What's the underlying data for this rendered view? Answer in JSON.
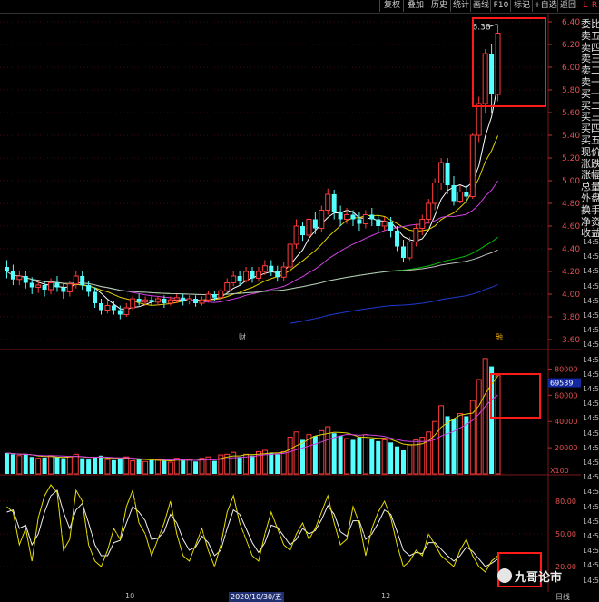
{
  "toolbar": {
    "buttons": [
      "复权",
      "叠加",
      "历史",
      "统计",
      "画线",
      "F10",
      "标记",
      "+自选",
      "返回"
    ],
    "corner": [
      "L",
      "R"
    ]
  },
  "right_panel": {
    "rows": [
      "委比",
      "卖五",
      "卖四",
      "卖三",
      "卖二",
      "卖一",
      "买一",
      "买二",
      "买三",
      "买四",
      "买五",
      "现价",
      "涨跌",
      "涨幅",
      "总量",
      "外盘",
      "换手",
      "净资",
      "收益"
    ]
  },
  "time_ticks": [
    "14:5",
    "14:5",
    "14:5",
    "14:5",
    "14:5",
    "14:5",
    "14:5",
    "14:5",
    "14:5",
    "14:5",
    "14:5",
    "14:5",
    "14:5",
    "14:5",
    "14:5",
    "14:5",
    "14:5",
    "14:5",
    "14:5",
    "14:5",
    "14:5",
    "14:5",
    "14:5",
    "14:5",
    "14:5",
    "14:5",
    "14:5",
    "14:5",
    "14:5",
    "14:5",
    "14:5",
    "14:5",
    "14:5",
    "14:5",
    "14:5",
    "14:5",
    "14:5",
    "14:5",
    "14:5",
    "14:5",
    "14:5",
    "14:5",
    "14:5",
    "14:5",
    "14:5",
    "14:5",
    "14:5",
    "14:5",
    "14:5",
    "14:5",
    "14:5",
    "14:5",
    "14:5",
    "14:5",
    "14:5",
    "14:5",
    "14:5",
    "14:5",
    "14:5",
    "14:5",
    "14:5",
    "14:5",
    "14:5",
    "14:5",
    "14:5",
    "14:5",
    "14:5",
    "14:5",
    "14:5",
    "14:5"
  ],
  "bottom_axis": {
    "labels": [
      "10",
      "2020/10/30/五",
      "12"
    ],
    "right_label": "日线"
  },
  "watermark": "九哥论市",
  "chart_data": {
    "type": "candlestick",
    "price_axis": {
      "ticks": [
        "6.40",
        "6.20",
        "6.00",
        "5.80",
        "5.60",
        "5.40",
        "5.20",
        "5.00",
        "4.80",
        "4.60",
        "4.40",
        "4.20",
        "4.00",
        "3.80",
        "3.60"
      ],
      "ylim": [
        3.52,
        6.48
      ]
    },
    "high_label": "6.38",
    "markers": [
      "财",
      "融"
    ],
    "candles": [
      [
        4.24,
        4.2,
        4.3,
        4.14
      ],
      [
        4.2,
        4.13,
        4.26,
        4.08
      ],
      [
        4.13,
        4.16,
        4.2,
        4.08
      ],
      [
        4.16,
        4.1,
        4.2,
        4.05
      ],
      [
        4.1,
        4.06,
        4.15,
        4.0
      ],
      [
        4.06,
        4.08,
        4.12,
        4.01
      ],
      [
        4.08,
        4.04,
        4.12,
        3.98
      ],
      [
        4.04,
        4.1,
        4.14,
        4.0
      ],
      [
        4.1,
        4.06,
        4.16,
        4.02
      ],
      [
        4.06,
        4.02,
        4.1,
        3.96
      ],
      [
        4.02,
        4.09,
        4.12,
        3.98
      ],
      [
        4.09,
        4.16,
        4.2,
        4.05
      ],
      [
        4.16,
        4.08,
        4.2,
        4.04
      ],
      [
        4.08,
        4.02,
        4.12,
        3.98
      ],
      [
        4.02,
        3.92,
        4.06,
        3.88
      ],
      [
        3.92,
        3.86,
        3.96,
        3.82
      ],
      [
        3.86,
        3.9,
        3.95,
        3.83
      ],
      [
        3.9,
        3.86,
        3.94,
        3.82
      ],
      [
        3.86,
        3.82,
        3.9,
        3.78
      ],
      [
        3.82,
        3.88,
        3.92,
        3.8
      ],
      [
        3.88,
        3.96,
        3.99,
        3.86
      ],
      [
        3.96,
        3.93,
        4.0,
        3.9
      ],
      [
        3.93,
        3.95,
        3.98,
        3.9
      ],
      [
        3.95,
        3.93,
        3.98,
        3.9
      ],
      [
        3.93,
        3.96,
        3.98,
        3.9
      ],
      [
        3.96,
        3.92,
        3.99,
        3.88
      ],
      [
        3.92,
        3.95,
        3.98,
        3.9
      ],
      [
        3.95,
        3.97,
        4.0,
        3.92
      ],
      [
        3.97,
        3.94,
        4.0,
        3.9
      ],
      [
        3.94,
        3.96,
        3.99,
        3.91
      ],
      [
        3.96,
        3.92,
        3.99,
        3.89
      ],
      [
        3.92,
        3.95,
        3.98,
        3.9
      ],
      [
        3.95,
        4.0,
        4.03,
        3.93
      ],
      [
        4.0,
        3.97,
        4.03,
        3.94
      ],
      [
        3.97,
        4.03,
        4.06,
        3.95
      ],
      [
        4.03,
        4.1,
        4.14,
        4.01
      ],
      [
        4.1,
        4.16,
        4.2,
        4.07
      ],
      [
        4.16,
        4.12,
        4.2,
        4.08
      ],
      [
        4.12,
        4.2,
        4.24,
        4.1
      ],
      [
        4.2,
        4.14,
        4.24,
        4.1
      ],
      [
        4.14,
        4.2,
        4.24,
        4.11
      ],
      [
        4.2,
        4.25,
        4.3,
        4.17
      ],
      [
        4.25,
        4.2,
        4.3,
        4.16
      ],
      [
        4.2,
        4.15,
        4.25,
        4.11
      ],
      [
        4.15,
        4.24,
        4.28,
        4.12
      ],
      [
        4.24,
        4.44,
        4.48,
        4.22
      ],
      [
        4.44,
        4.6,
        4.66,
        4.4
      ],
      [
        4.6,
        4.52,
        4.64,
        4.47
      ],
      [
        4.52,
        4.66,
        4.7,
        4.48
      ],
      [
        4.66,
        4.58,
        4.72,
        4.53
      ],
      [
        4.58,
        4.74,
        4.78,
        4.55
      ],
      [
        4.74,
        4.88,
        4.93,
        4.7
      ],
      [
        4.88,
        4.72,
        4.92,
        4.66
      ],
      [
        4.72,
        4.66,
        4.78,
        4.6
      ],
      [
        4.66,
        4.7,
        4.76,
        4.62
      ],
      [
        4.7,
        4.66,
        4.74,
        4.6
      ],
      [
        4.66,
        4.62,
        4.72,
        4.56
      ],
      [
        4.62,
        4.7,
        4.74,
        4.58
      ],
      [
        4.7,
        4.66,
        4.76,
        4.6
      ],
      [
        4.66,
        4.6,
        4.7,
        4.55
      ],
      [
        4.6,
        4.64,
        4.68,
        4.56
      ],
      [
        4.64,
        4.56,
        4.68,
        4.5
      ],
      [
        4.56,
        4.42,
        4.6,
        4.38
      ],
      [
        4.42,
        4.32,
        4.48,
        4.28
      ],
      [
        4.32,
        4.46,
        4.5,
        4.3
      ],
      [
        4.46,
        4.58,
        4.62,
        4.42
      ],
      [
        4.58,
        4.66,
        4.7,
        4.52
      ],
      [
        4.66,
        4.8,
        4.84,
        4.62
      ],
      [
        4.8,
        4.98,
        5.02,
        4.74
      ],
      [
        4.98,
        5.16,
        5.2,
        4.92
      ],
      [
        5.16,
        4.96,
        5.2,
        4.88
      ],
      [
        4.96,
        4.82,
        5.04,
        4.78
      ],
      [
        4.82,
        4.9,
        4.96,
        4.8
      ],
      [
        4.9,
        4.86,
        4.96,
        4.8
      ],
      [
        4.86,
        5.4,
        5.42,
        4.84
      ],
      [
        5.4,
        5.68,
        5.74,
        5.34
      ],
      [
        5.68,
        6.12,
        6.16,
        5.6
      ],
      [
        6.12,
        5.76,
        6.2,
        5.6
      ],
      [
        5.76,
        6.3,
        6.38,
        5.7
      ]
    ],
    "ma_lines": {
      "ma5": {
        "color": "#ffffff"
      },
      "ma10": {
        "color": "#e0d000"
      },
      "ma20": {
        "color": "#d040e0"
      },
      "ma60": {
        "color": "#00c000"
      },
      "ma120": {
        "color": "#c0c0c0"
      },
      "ma250": {
        "color": "#1e3ad0"
      }
    },
    "volume_axis": {
      "ticks": [
        "80000",
        "60000",
        "40000",
        "20000"
      ],
      "unit": "X100",
      "current": "69539",
      "ylim": [
        0,
        90000
      ]
    },
    "volumes": [
      16000,
      15000,
      14000,
      15000,
      13000,
      12000,
      12500,
      14000,
      13000,
      12000,
      13500,
      15000,
      12000,
      11000,
      12500,
      14000,
      11000,
      10500,
      12000,
      13000,
      10000,
      11000,
      9500,
      10500,
      11000,
      10000,
      9000,
      12000,
      10500,
      11000,
      9500,
      12000,
      13000,
      10000,
      14500,
      15000,
      16500,
      13000,
      15000,
      14000,
      17000,
      18000,
      16000,
      15000,
      17000,
      28000,
      32000,
      26000,
      30000,
      29000,
      33000,
      36000,
      31000,
      29000,
      27000,
      26000,
      28000,
      30000,
      27000,
      25000,
      26000,
      24000,
      21000,
      18000,
      22000,
      26000,
      28000,
      32000,
      40000,
      52000,
      44000,
      42000,
      46000,
      44000,
      56000,
      72000,
      88000,
      82000,
      75000
    ],
    "kdj_axis": {
      "ticks": [
        "80.00",
        "50.00",
        "20.00"
      ],
      "ylim": [
        0,
        100
      ]
    },
    "kdj_k": [
      75,
      70,
      40,
      55,
      25,
      65,
      85,
      95,
      88,
      35,
      45,
      90,
      80,
      40,
      25,
      20,
      35,
      55,
      45,
      75,
      90,
      60,
      50,
      30,
      45,
      60,
      80,
      50,
      30,
      25,
      40,
      55,
      35,
      20,
      40,
      70,
      85,
      60,
      45,
      30,
      25,
      50,
      70,
      55,
      40,
      35,
      50,
      60,
      45,
      55,
      70,
      85,
      60,
      40,
      45,
      75,
      60,
      30,
      55,
      70,
      80,
      65,
      40,
      20,
      25,
      35,
      30,
      50,
      40,
      30,
      25,
      20,
      35,
      45,
      30,
      20,
      15,
      25,
      30
    ],
    "kdj_d": [
      70,
      72,
      55,
      58,
      40,
      50,
      70,
      85,
      90,
      70,
      55,
      72,
      78,
      60,
      40,
      30,
      30,
      42,
      44,
      60,
      75,
      70,
      62,
      45,
      46,
      52,
      68,
      60,
      45,
      35,
      38,
      48,
      42,
      30,
      35,
      55,
      72,
      68,
      55,
      42,
      33,
      42,
      58,
      56,
      48,
      40,
      45,
      55,
      50,
      53,
      63,
      76,
      68,
      52,
      48,
      62,
      62,
      45,
      50,
      60,
      72,
      68,
      52,
      35,
      30,
      33,
      32,
      42,
      42,
      36,
      30,
      25,
      30,
      38,
      34,
      27,
      20,
      23,
      27
    ]
  }
}
